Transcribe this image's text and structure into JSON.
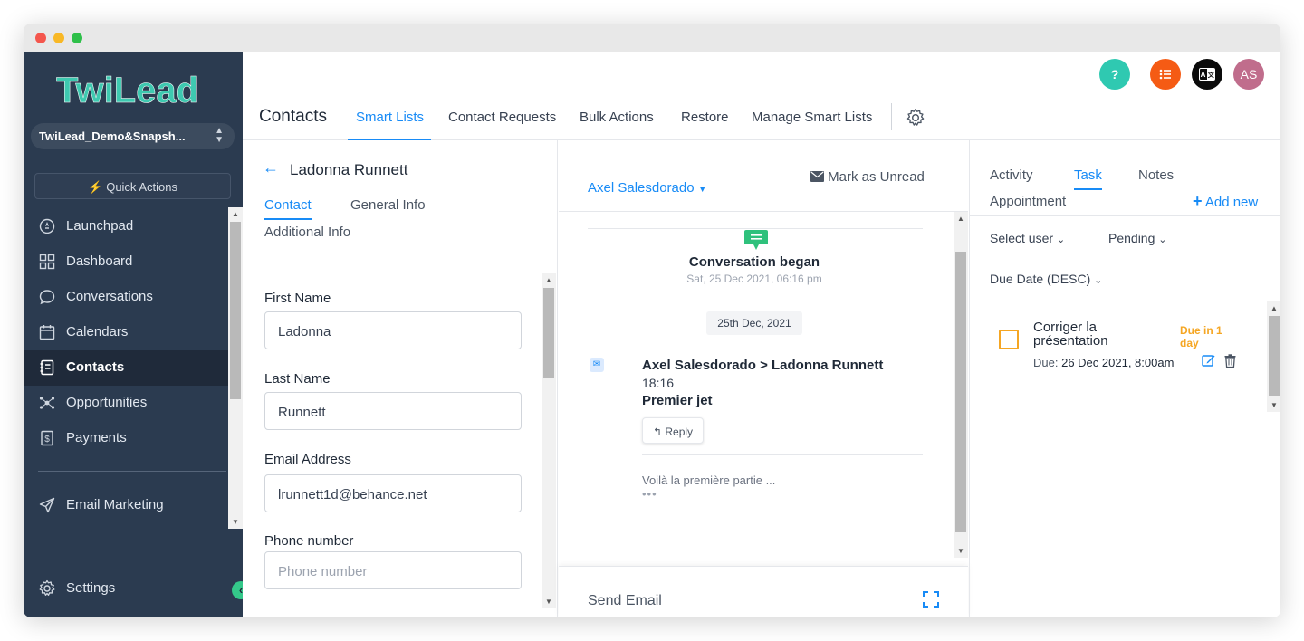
{
  "brand": {
    "logo_text": "TwiLead",
    "accent": "#188bf6",
    "sidebar_bg": "#2b3b50",
    "logo_color": "#3ec9b0"
  },
  "sidebar": {
    "location_name": "TwiLead_Demo&Snapsh...",
    "quick_actions": "Quick Actions",
    "items": [
      {
        "label": "Launchpad",
        "icon": "rocket-icon"
      },
      {
        "label": "Dashboard",
        "icon": "dashboard-icon"
      },
      {
        "label": "Conversations",
        "icon": "chat-icon"
      },
      {
        "label": "Calendars",
        "icon": "calendar-icon"
      },
      {
        "label": "Contacts",
        "icon": "contacts-icon",
        "active": true
      },
      {
        "label": "Opportunities",
        "icon": "funnel-icon"
      },
      {
        "label": "Payments",
        "icon": "payments-icon"
      }
    ],
    "email_marketing": "Email Marketing",
    "settings": "Settings"
  },
  "header": {
    "title": "Contacts",
    "tabs": [
      "Smart Lists",
      "Contact Requests",
      "Bulk Actions",
      "Restore",
      "Manage Smart Lists"
    ],
    "active_tab": "Smart Lists",
    "avatar_initials": "AS",
    "help_label": "?"
  },
  "contact": {
    "name": "Ladonna Runnett",
    "tabs": [
      "Contact",
      "General Info",
      "Additional Info"
    ],
    "fields": {
      "first_name_label": "First Name",
      "first_name": "Ladonna",
      "last_name_label": "Last Name",
      "last_name": "Runnett",
      "email_label": "Email Address",
      "email": "lrunnett1d@behance.net",
      "phone_label": "Phone number",
      "phone_placeholder": "Phone number"
    }
  },
  "conversation": {
    "assignee": "Axel Salesdorado",
    "mark_unread": "Mark as Unread",
    "began_label": "Conversation began",
    "began_date": "Sat, 25 Dec 2021, 06:16 pm",
    "date_pill": "25th Dec, 2021",
    "message": {
      "from": "Axel Salesdorado",
      "to": "Ladonna Runnett",
      "separator": ">",
      "time": "18:16",
      "subject": "Premier jet",
      "reply_label": "Reply",
      "preview": "Voilà la première partie ...",
      "more": "•••"
    },
    "send_email_label": "Send Email"
  },
  "right_panel": {
    "tabs": [
      "Activity",
      "Task",
      "Notes",
      "Appointment"
    ],
    "active_tab": "Task",
    "add_new": "Add new",
    "select_user": "Select user",
    "status_filter": "Pending",
    "sort": "Due Date (DESC)",
    "task": {
      "title": "Corriger la présentation",
      "due_in": "Due in 1 day",
      "due_label": "Due:",
      "due_value": "26 Dec 2021, 8:00am",
      "status_color": "#f5a623"
    }
  }
}
